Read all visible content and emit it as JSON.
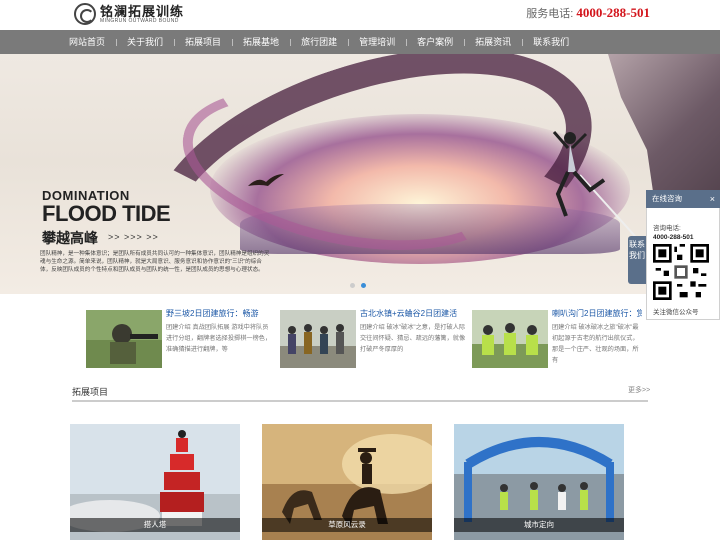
{
  "header": {
    "logo_cn": "铭澜拓展训练",
    "logo_en": "MINGRUN OUTWARD BOUND",
    "hotline_label": "服务电话:",
    "hotline_number": "4000-288-501"
  },
  "nav": {
    "items": [
      "网站首页",
      "关于我们",
      "拓展项目",
      "拓展基地",
      "旅行团建",
      "管理培训",
      "客户案例",
      "拓展资讯",
      "联系我们"
    ]
  },
  "banner": {
    "headline_small": "DOMINATION",
    "headline_big": "FLOOD TIDE",
    "headline_cn": "攀越高峰",
    "arrows": ">> >>> >>",
    "body_text": "团队精神，是一种集体意识；是团队所有成员共同认可的一种集体意识，团队精神是组织的灵魂与生命之源。简单来说，团队精神，就是大局意识、服务意识和协作意识的“三识”的综合体，反映团队成员的个性特点和团队成员与团队的统一性，是团队成员的思想与心理状态。"
  },
  "news": [
    {
      "title": "野三坡2日团建旅行：畅游",
      "desc": "团建介绍 真战团队拓展 游戏中将队员进行分组，翻牌者选择投掷棋一榜色，准确猜描进行翻牌，等"
    },
    {
      "title": "古北水镇+云蛐谷2日团建活",
      "desc": "团建介绍 破冰\"破冰\"之意，是打破人际交往间怀疑、猜忌、疏远的藩篱，就像打破严冬厚厚的"
    },
    {
      "title": "喇叭沟门2日团建旅行：赏",
      "desc": "团建介绍 破冰破冰之旅\"破冰\"最初起源于古老的航行出航仪式，那是一个庄严、壮观的场面，所有"
    }
  ],
  "section": {
    "title": "拓展项目",
    "more": "更多>>"
  },
  "projects": [
    {
      "caption": "搭人塔"
    },
    {
      "caption": "草原风云录"
    },
    {
      "caption": "城市定向"
    }
  ],
  "float_panel": {
    "header": "在线咨询",
    "close": "×",
    "side_tab": "联系我们",
    "label": "咨询电话:",
    "phone": "4000-288-501",
    "footer": "关注微信公众号"
  },
  "carousel": {
    "total": 2,
    "active": 2
  }
}
